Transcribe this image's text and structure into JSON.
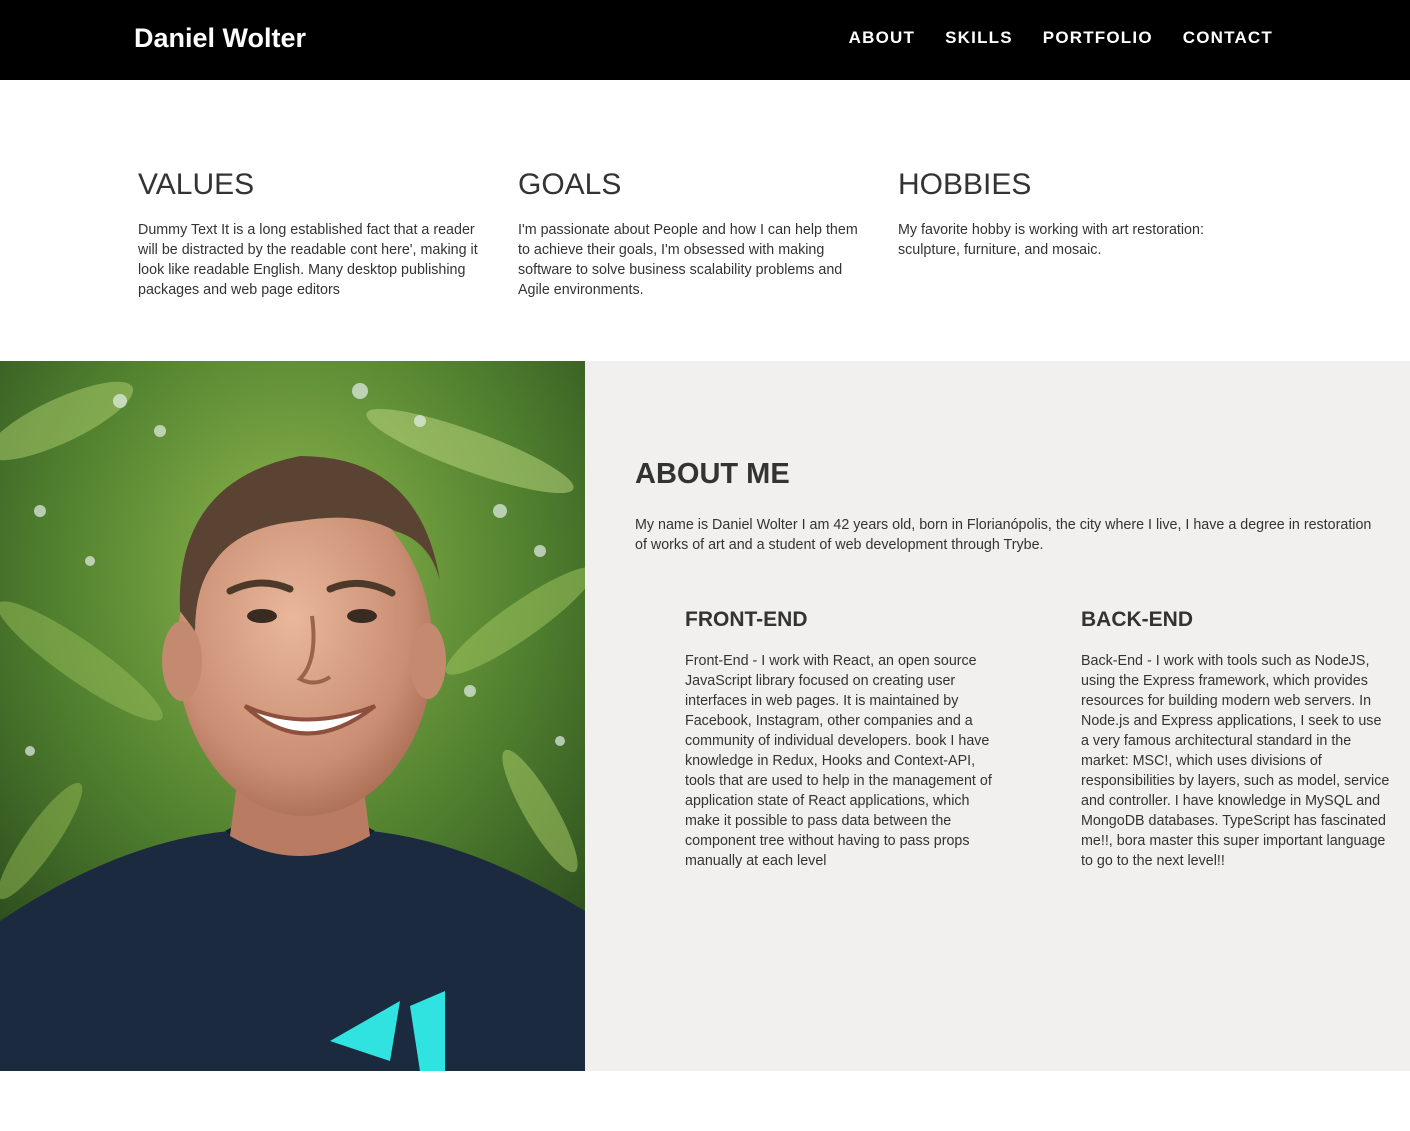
{
  "header": {
    "brand": "Daniel Wolter",
    "nav": [
      "ABOUT",
      "SKILLS",
      "PORTFOLIO",
      "CONTACT"
    ]
  },
  "columns": [
    {
      "title": "VALUES",
      "text": "Dummy Text It is a long established fact that a reader will be distracted by the readable cont here', making it look like readable English. Many desktop publishing packages and web page editors"
    },
    {
      "title": "GOALS",
      "text": "I'm passionate about People and how I can help them to achieve their goals, I'm obsessed with making software to solve business scalability problems and Agile environments."
    },
    {
      "title": "HOBBIES",
      "text": "My favorite hobby is working with art restoration: sculpture, furniture, and mosaic."
    }
  ],
  "about": {
    "title": "ABOUT ME",
    "intro": "My name is Daniel Wolter I am 42 years old, born in Florianópolis, the city where I live, I have a degree in restoration of works of art and a student of web development through Trybe.",
    "photo_icon": "portrait-photo"
  },
  "skills": [
    {
      "title": "FRONT-END",
      "text": "Front-End - I work with React, an open source JavaScript library focused on creating user interfaces in web pages. It is maintained by Facebook, Instagram, other companies and a community of individual developers. book I have knowledge in Redux, Hooks and Context-API, tools that are used to help in the management of application state of React applications, which make it possible to pass data between the component tree without having to pass props manually at each level"
    },
    {
      "title": "BACK-END",
      "text": "Back-End - I work with tools such as NodeJS, using the Express framework, which provides resources for building modern web servers. In Node.js and Express applications, I seek to use a very famous architectural standard in the market: MSC!, which uses divisions of responsibilities by layers, such as model, service and controller. I have knowledge in MySQL and MongoDB databases. TypeScript has fascinated me!!, bora master this super important language to go to the next level!!"
    }
  ],
  "colors": {
    "header_bg": "#000000",
    "about_bg": "#f1f0ef",
    "text": "#333333"
  }
}
